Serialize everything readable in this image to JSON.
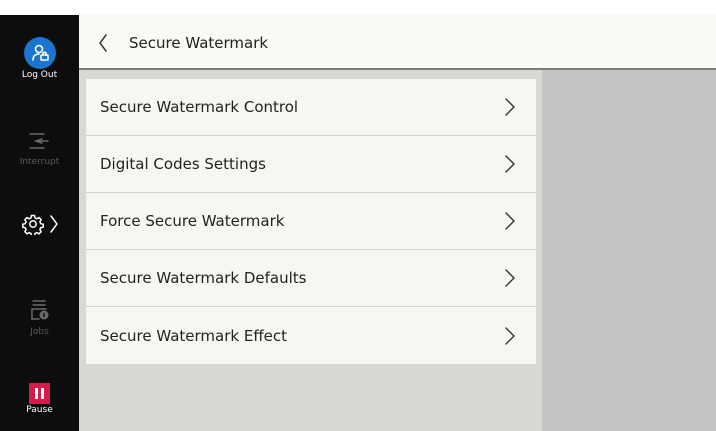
{
  "sidebar": {
    "logout_label": "Log Out",
    "interrupt_label": "Interrupt",
    "jobs_label": "Jobs",
    "pause_label": "Pause",
    "settings_icon": "gear-icon"
  },
  "header": {
    "title": "Secure Watermark",
    "back_icon": "chevron-left-icon"
  },
  "menu": {
    "items": [
      {
        "label": "Secure Watermark Control"
      },
      {
        "label": "Digital Codes Settings"
      },
      {
        "label": "Force Secure Watermark"
      },
      {
        "label": "Secure Watermark Defaults"
      },
      {
        "label": "Secure Watermark Effect"
      }
    ]
  },
  "colors": {
    "sidebar_bg": "#0d0d0d",
    "logout_blue": "#1b74d0",
    "pause_red": "#d41c4b",
    "header_bg": "#faf9f6",
    "content_bg": "#d9d8d4",
    "right_pane_bg": "#c4c4c2",
    "menu_item_bg": "#f7f6f2"
  }
}
